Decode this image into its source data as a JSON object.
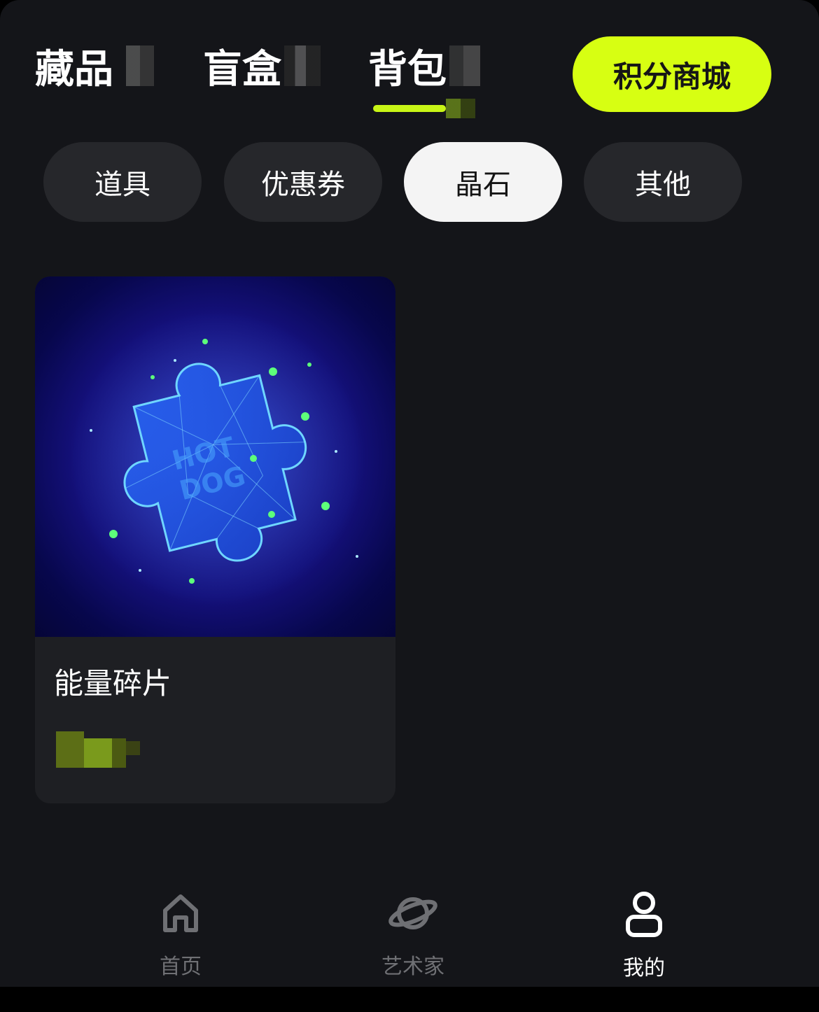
{
  "top_tabs": [
    {
      "label": "藏品",
      "active": false
    },
    {
      "label": "盲盒",
      "active": false
    },
    {
      "label": "背包",
      "active": true
    }
  ],
  "points_mall": {
    "label": "积分商城",
    "color": "#d7ff12"
  },
  "categories": [
    {
      "label": "道具",
      "active": false
    },
    {
      "label": "优惠券",
      "active": false
    },
    {
      "label": "晶石",
      "active": true
    },
    {
      "label": "其他",
      "active": false
    }
  ],
  "items": [
    {
      "title": "能量碎片",
      "image_icon": "puzzle-piece-icon",
      "image_text": "HOT DOG"
    }
  ],
  "bottom_nav": [
    {
      "label": "首页",
      "icon": "home-icon",
      "active": false
    },
    {
      "label": "艺术家",
      "icon": "planet-icon",
      "active": false
    },
    {
      "label": "我的",
      "icon": "user-icon",
      "active": true
    }
  ],
  "colors": {
    "accent": "#c8f516",
    "background": "#141519",
    "card": "#1e1f23",
    "chip": "#26272b"
  }
}
